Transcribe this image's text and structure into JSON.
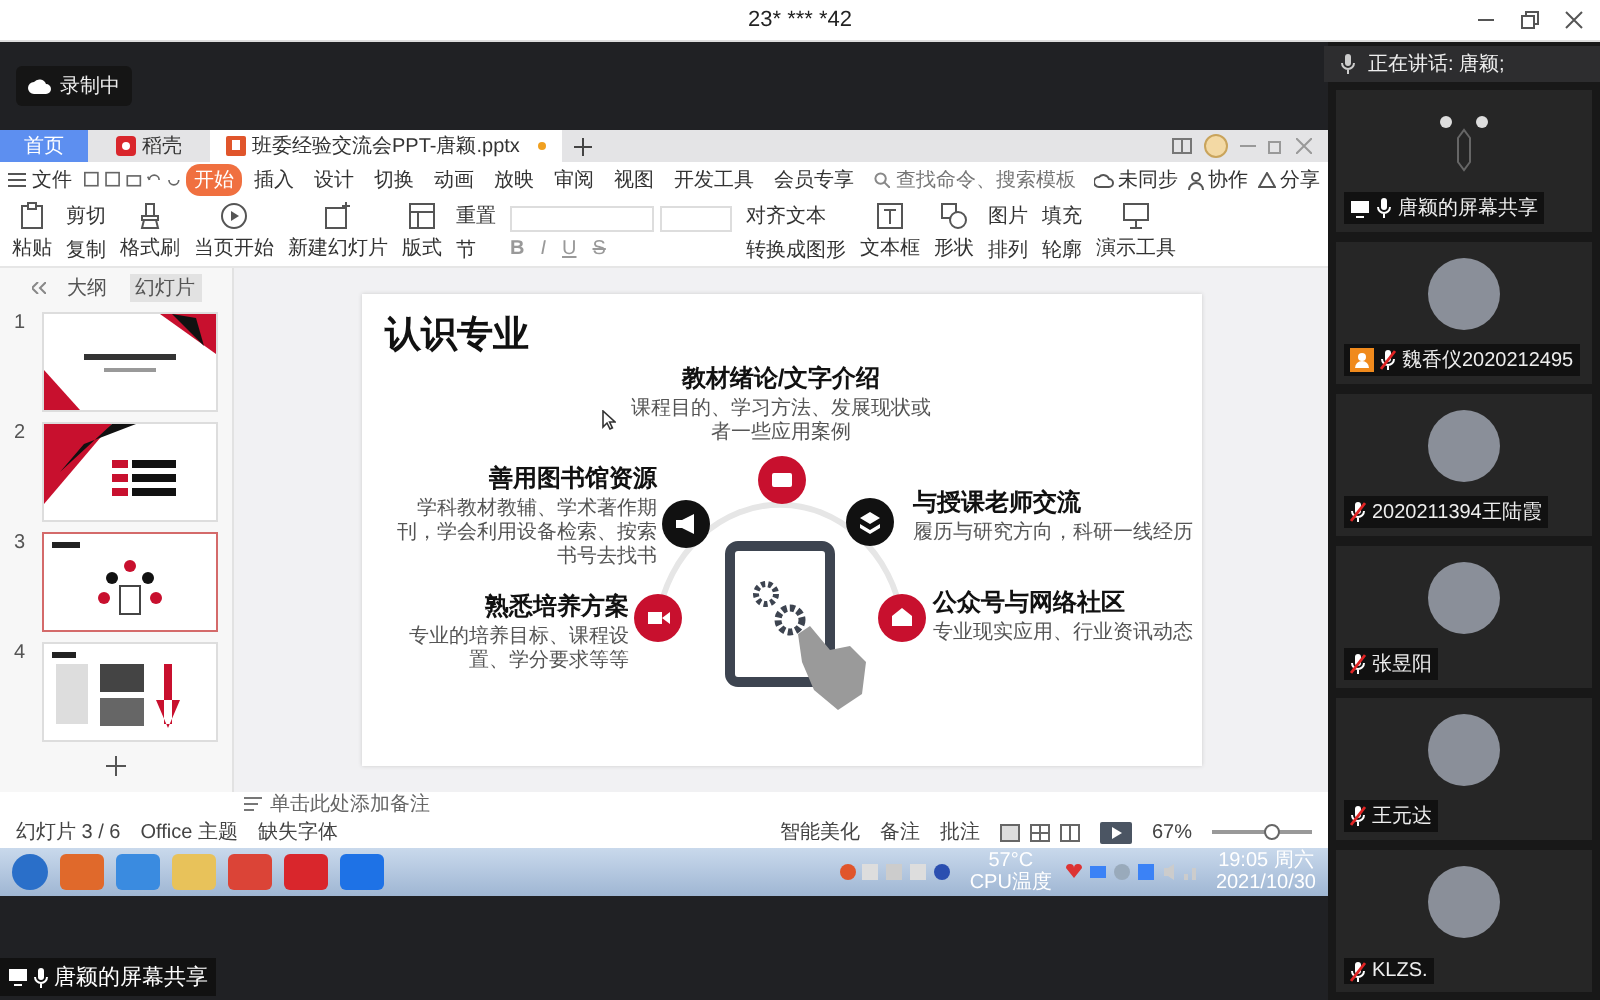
{
  "meeting": {
    "title": "23* *** *42",
    "recording": "录制中",
    "speaking": "正在讲话: 唐颖;",
    "share_label": "唐颖的屏幕共享"
  },
  "participants": [
    {
      "name": "唐颖的屏幕共享",
      "kind": "screen",
      "muted": false,
      "host": false
    },
    {
      "name": "魏香仪2020212495",
      "kind": "avatar",
      "muted": true,
      "host": true
    },
    {
      "name": "2020211394王陆霞",
      "kind": "avatar",
      "muted": true,
      "host": false
    },
    {
      "name": "张昱阳",
      "kind": "avatar",
      "muted": true,
      "host": false
    },
    {
      "name": "王元达",
      "kind": "avatar",
      "muted": true,
      "host": false
    },
    {
      "name": "KLZS.",
      "kind": "avatar",
      "muted": true,
      "host": false
    }
  ],
  "wps": {
    "tabs": [
      {
        "label": "首页",
        "kind": "home",
        "selected": false
      },
      {
        "label": "稻壳",
        "kind": "docer",
        "selected": false
      },
      {
        "label": "班委经验交流会PPT-唐颖.pptx",
        "kind": "doc",
        "selected": true
      }
    ],
    "file_menu": "文件",
    "menu_tabs": [
      {
        "label": "开始",
        "selected": true
      },
      {
        "label": "插入",
        "selected": false
      },
      {
        "label": "设计",
        "selected": false
      },
      {
        "label": "切换",
        "selected": false
      },
      {
        "label": "动画",
        "selected": false
      },
      {
        "label": "放映",
        "selected": false
      },
      {
        "label": "审阅",
        "selected": false
      },
      {
        "label": "视图",
        "selected": false
      },
      {
        "label": "开发工具",
        "selected": false
      },
      {
        "label": "会员专享",
        "selected": false
      }
    ],
    "search": {
      "placeholder": "查找命令、搜索模板"
    },
    "actions": [
      {
        "label": "未同步",
        "kind": "cloud"
      },
      {
        "label": "协作",
        "kind": "people"
      },
      {
        "label": "分享",
        "kind": "share"
      }
    ],
    "ribbon": [
      {
        "kind": "big",
        "label": "粘贴"
      },
      {
        "kind": "stack",
        "items": [
          "剪切",
          "复制"
        ]
      },
      {
        "kind": "big",
        "label": "格式刷"
      },
      {
        "kind": "big",
        "label": "当页开始"
      },
      {
        "kind": "big",
        "label": "新建幻灯片"
      },
      {
        "kind": "big",
        "label": "版式"
      },
      {
        "kind": "stack",
        "items": [
          "重置",
          "节"
        ]
      },
      {
        "kind": "font",
        "items": [
          "B",
          "I",
          "U",
          "S"
        ]
      },
      {
        "kind": "stack",
        "items": [
          "对齐文本",
          "转换成图形"
        ]
      },
      {
        "kind": "big",
        "label": "文本框"
      },
      {
        "kind": "big",
        "label": "形状"
      },
      {
        "kind": "stack",
        "items": [
          "图片",
          "排列"
        ]
      },
      {
        "kind": "stack",
        "items": [
          "填充",
          "轮廓"
        ]
      },
      {
        "kind": "big",
        "label": "演示工具"
      }
    ],
    "panel_tabs": [
      {
        "label": "大纲",
        "selected": false
      },
      {
        "label": "幻灯片",
        "selected": true
      }
    ],
    "thumbnails": [
      {
        "number": "1",
        "kind": "cover",
        "selected": false
      },
      {
        "number": "2",
        "kind": "contents",
        "selected": false
      },
      {
        "number": "3",
        "kind": "diagram",
        "selected": true
      },
      {
        "number": "4",
        "kind": "photos",
        "selected": false
      }
    ],
    "slide": {
      "title": "认识专业",
      "items": [
        {
          "heading": "教材绪论/文字介绍",
          "text": "课程目的、学习方法、发展现状或者一些应用案例",
          "color": "#c8102e"
        },
        {
          "heading": "善用图书馆资源",
          "text": "学科教材教辅、学术著作期刊，学会利用设备检索、按索书号去找书",
          "color": "#111111"
        },
        {
          "heading": "与授课老师交流",
          "text": "履历与研究方向，科研一线经历",
          "color": "#111111"
        },
        {
          "heading": "熟悉培养方案",
          "text": "专业的培养目标、课程设置、学分要求等等",
          "color": "#c8102e"
        },
        {
          "heading": "公众号与网络社区",
          "text": "专业现实应用、行业资讯动态",
          "color": "#c8102e"
        }
      ]
    },
    "notes_placeholder": "单击此处添加备注",
    "status": {
      "slide": "幻灯片 3 / 6",
      "theme": "Office 主题",
      "missing_font": "缺失字体",
      "beautify": "智能美化",
      "notes": "备注",
      "comments": "批注",
      "zoom": "67%"
    },
    "zoom_slider": {
      "level": 0.6
    }
  },
  "taskbar": {
    "apps": [
      {
        "kind": "start"
      },
      {
        "kind": "tiles"
      },
      {
        "kind": "search"
      },
      {
        "kind": "folder"
      },
      {
        "kind": "chrome"
      },
      {
        "kind": "wps"
      },
      {
        "kind": "meeting"
      }
    ],
    "temp": "57°C",
    "temp_label": "CPU温度",
    "time": "19:05 周六",
    "date": "2021/10/30"
  }
}
